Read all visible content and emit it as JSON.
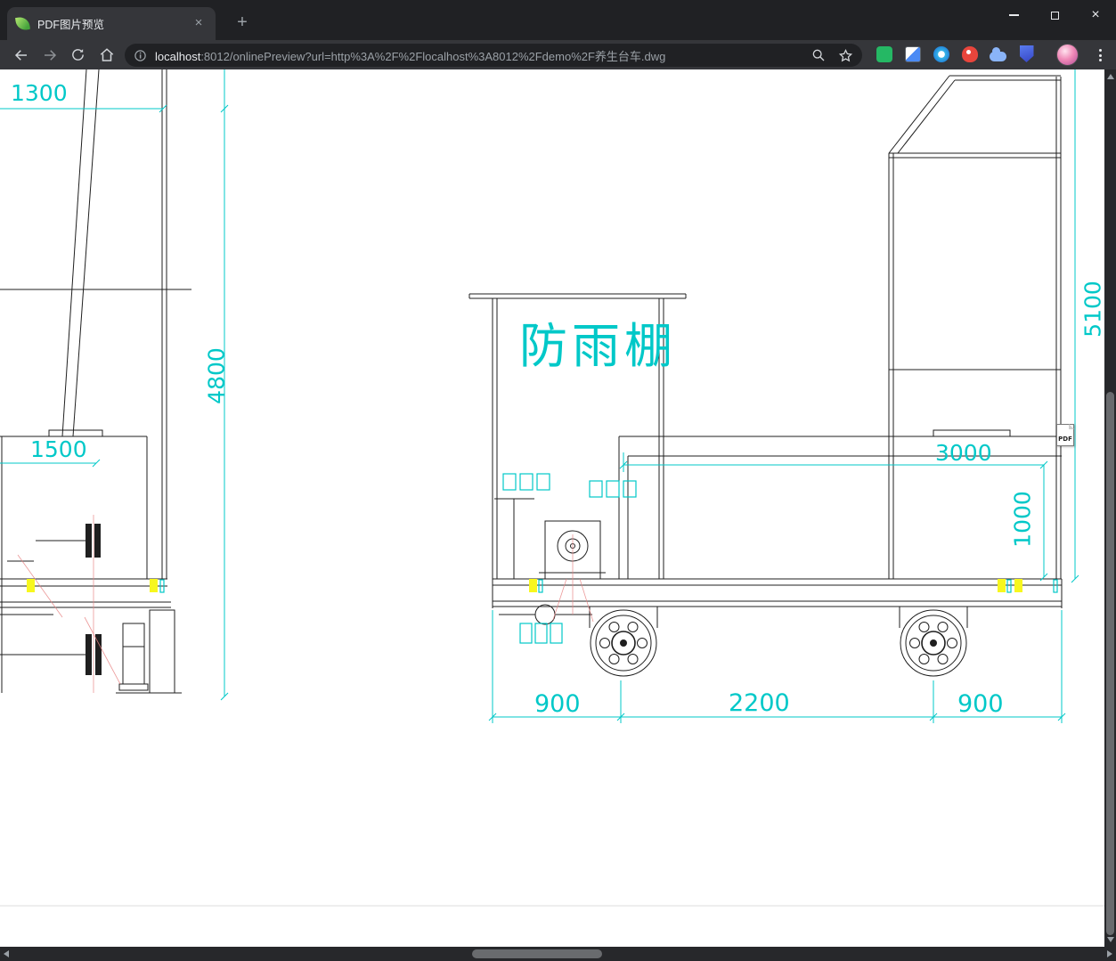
{
  "window": {
    "tab_title": "PDF图片预览",
    "close_glyph": "×",
    "new_tab_glyph": "+"
  },
  "toolbar": {
    "url_host": "localhost",
    "url_rest": ":8012/onlinePreview?url=http%3A%2F%2Flocalhost%3A8012%2Fdemo%2F养生台车.dwg"
  },
  "drawing": {
    "shelter_label": "防雨棚",
    "pdf_badge": "PDF",
    "dims": {
      "top_width": "1300",
      "mast_height": "4800",
      "pedestal_width": "1500",
      "frame_height": "5100",
      "body_width": "3000",
      "body_height": "1000",
      "left_overhang": "900",
      "wheelbase": "2200",
      "right_overhang": "900"
    }
  }
}
